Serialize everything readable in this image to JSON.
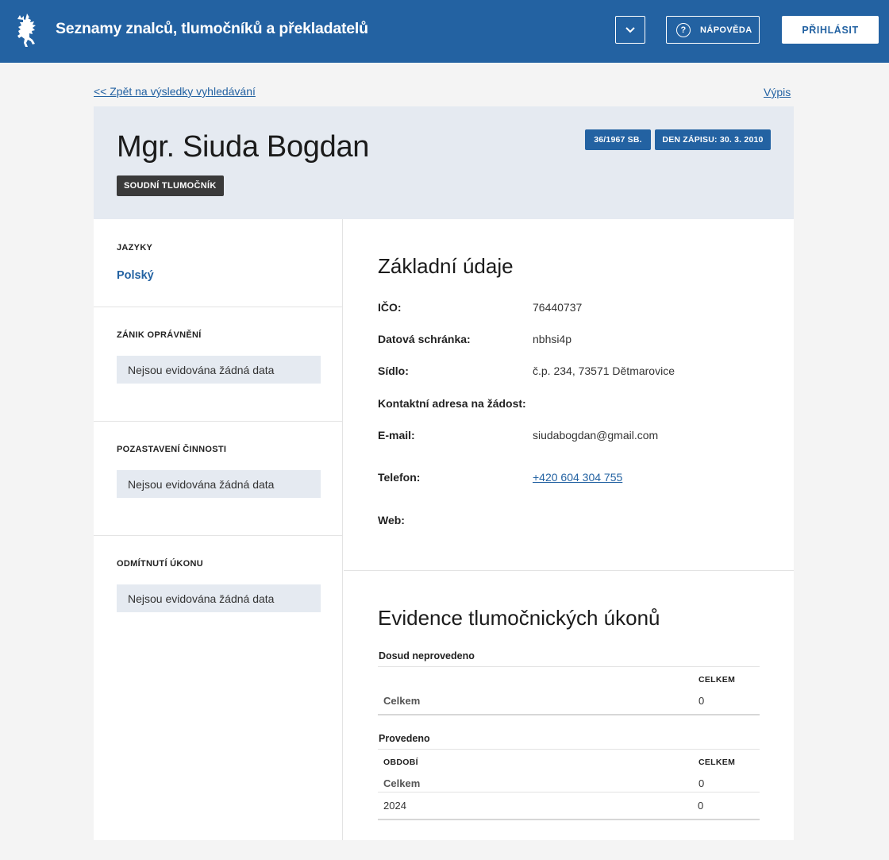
{
  "header": {
    "title": "Seznamy znalců, tlumočníků a překladatelů",
    "help_label": "NÁPOVĚDA",
    "login_label": "PŘIHLÁSIT"
  },
  "nav": {
    "back_link": "<< Zpět na výsledky vyhledávání",
    "export_link": "Výpis"
  },
  "profile": {
    "name": "Mgr. Siuda Bogdan",
    "role": "SOUDNÍ TLUMOČNÍK",
    "law_tag": "36/1967 SB.",
    "date_tag": "DEN ZÁPISU: 30. 3. 2010"
  },
  "sidebar": {
    "languages_title": "JAZYKY",
    "language": "Polský",
    "sections": [
      {
        "title": "ZÁNIK OPRÁVNĚNÍ",
        "value": "Nejsou evidována žádná data"
      },
      {
        "title": "POZASTAVENÍ ČINNOSTI",
        "value": "Nejsou evidována žádná data"
      },
      {
        "title": "ODMÍTNUTÍ ÚKONU",
        "value": "Nejsou evidována žádná data"
      }
    ]
  },
  "basic": {
    "title": "Základní údaje",
    "rows": [
      {
        "label": "IČO:",
        "value": "76440737"
      },
      {
        "label": "Datová schránka:",
        "value": "nbhsi4p"
      },
      {
        "label": "Sídlo:",
        "value": "č.p. 234, 73571 Dětmarovice"
      },
      {
        "label": "Kontaktní adresa na žádost:",
        "value": ""
      },
      {
        "label": "E-mail:",
        "value": "siudabogdan@gmail.com"
      },
      {
        "label": "Telefon:",
        "value": "+420 604 304 755"
      },
      {
        "label": "Web:",
        "value": ""
      }
    ]
  },
  "records": {
    "title": "Evidence tlumočnických úkonů",
    "pending": {
      "caption": "Dosud neprovedeno",
      "col_total": "CELKEM",
      "row_label": "Celkem",
      "row_value": "0"
    },
    "done": {
      "caption": "Provedeno",
      "col_period": "OBDOBÍ",
      "col_total": "CELKEM",
      "rows": [
        {
          "period": "Celkem",
          "total": "0"
        },
        {
          "period": "2024",
          "total": "0"
        }
      ]
    }
  }
}
